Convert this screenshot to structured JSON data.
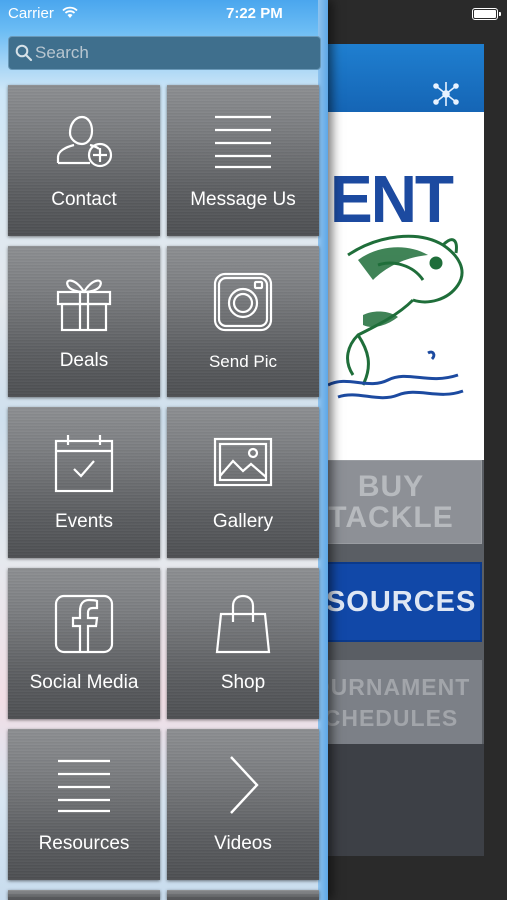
{
  "status_bar": {
    "carrier": "Carrier",
    "time": "7:22 PM"
  },
  "search": {
    "placeholder": "Search"
  },
  "menu": [
    {
      "label": "Contact",
      "icon": "add-contact-icon"
    },
    {
      "label": "Message Us",
      "icon": "lines-icon"
    },
    {
      "label": "Deals",
      "icon": "gift-icon"
    },
    {
      "label": "Send Pic",
      "icon": "camera-icon"
    },
    {
      "label": "Events",
      "icon": "calendar-check-icon"
    },
    {
      "label": "Gallery",
      "icon": "image-icon"
    },
    {
      "label": "Social Media",
      "icon": "facebook-icon"
    },
    {
      "label": "Shop",
      "icon": "shopping-bag-icon"
    },
    {
      "label": "Resources",
      "icon": "list-icon"
    },
    {
      "label": "Videos",
      "icon": "chevron-right-icon"
    }
  ],
  "background_app": {
    "logo_text": "ENT",
    "buttons": {
      "buy_line1": "BUY",
      "buy_line2": "TACKLE",
      "resources": "ESOURCES",
      "tournament_line1": "OURNAMENT",
      "tournament_line2": "CHEDULES"
    }
  },
  "colors": {
    "drawer_accent": "#4aa6ee",
    "tile": "#6a6c6f",
    "bg_header": "#1565b5",
    "bg_resources": "#1148a8"
  }
}
